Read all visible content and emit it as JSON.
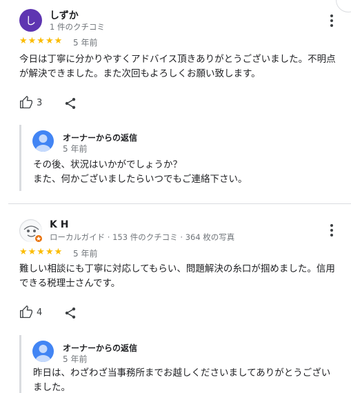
{
  "reviews": [
    {
      "author": "しずか",
      "avatar_letter": "し",
      "meta": "1 件のクチコミ",
      "stars": "★★★★★",
      "rating": 5,
      "time": "5 年前",
      "text": "今日は丁寧に分かりやすくアドバイス頂きありがとうございました。不明点が解決できました。また次回もよろしくお願い致します。",
      "likes": "3",
      "owner_reply": {
        "title": "オーナーからの返信",
        "time": "5 年前",
        "text": "その後、状況はいかがでしょうか？\nまた、何かございましたらいつでもご連絡下さい。"
      }
    },
    {
      "author": "K H",
      "meta": "ローカルガイド · 153 件のクチコミ · 364 枚の写真",
      "stars": "★★★★★",
      "rating": 5,
      "time": "5 年前",
      "text": "難しい相談にも丁寧に対応してもらい、問題解決の糸口が掴めました。信用できる税理士さんです。",
      "likes": "4",
      "owner_reply": {
        "title": "オーナーからの返信",
        "time": "5 年前",
        "text": "昨日は、わざわざ当事務所までお越しくださいましてありがとうございました。"
      }
    }
  ],
  "colors": {
    "star": "#fbbc04",
    "avatar_purple": "#5e35b1",
    "owner_avatar": "#4285f4",
    "local_guide_badge": "#e8710a"
  },
  "icons": {
    "more": "more-vert-icon",
    "like": "thumb-up-icon",
    "share": "share-icon",
    "local_guide": "local-guide-badge-icon"
  }
}
